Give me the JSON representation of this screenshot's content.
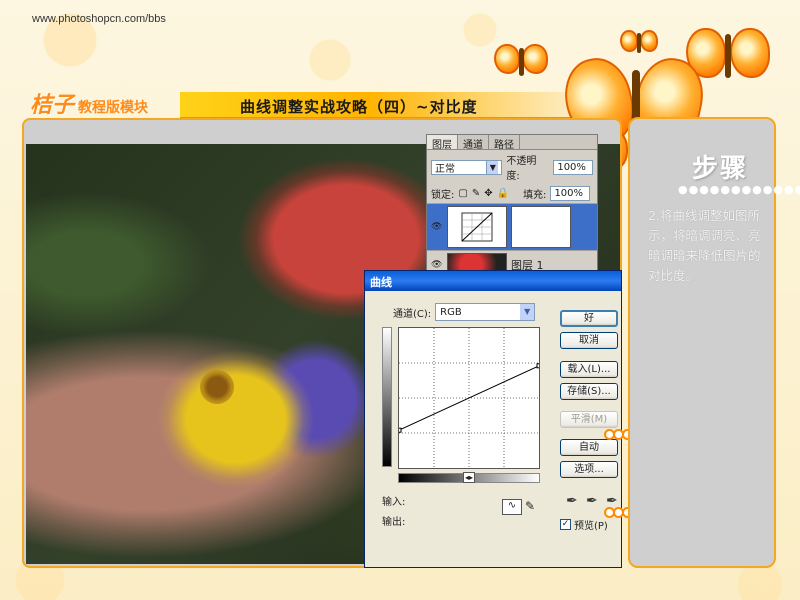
{
  "site_url": "www.photoshopcn.com/bbs",
  "brand": {
    "name": "桔子",
    "sub": "教程版模块"
  },
  "title": "曲线调整实战攻略（四）~对比度",
  "layers_panel": {
    "tabs": [
      "图层",
      "通道",
      "路径"
    ],
    "blend_mode": "正常",
    "opacity_label": "不透明度:",
    "opacity_value": "100%",
    "lock_label": "锁定:",
    "fill_label": "填充:",
    "fill_value": "100%",
    "layer2_label": "图层 1"
  },
  "curves_dialog": {
    "title": "曲线",
    "channel_label": "通道(C):",
    "channel_value": "RGB",
    "input_label": "输入:",
    "output_label": "输出:",
    "buttons": {
      "ok": "好",
      "cancel": "取消",
      "load": "载入(L)...",
      "save": "存储(S)...",
      "smooth": "平滑(M)",
      "auto": "自动",
      "options": "选项..."
    },
    "preview_label": "预览(P)",
    "preview_checked": true,
    "curve_points": [
      [
        0,
        0.27
      ],
      [
        1,
        0.73
      ]
    ]
  },
  "side": {
    "steps_label": "步骤",
    "dots": "●●●●●●●●●●●●",
    "instruction": "2.将曲线调整如图所示，将暗调调亮、亮暗调暗来降低图片的对比度。"
  },
  "colors": {
    "accent": "#f5a623",
    "title_bar": "#ffc400",
    "panel_grey": "#cfcfcf"
  }
}
